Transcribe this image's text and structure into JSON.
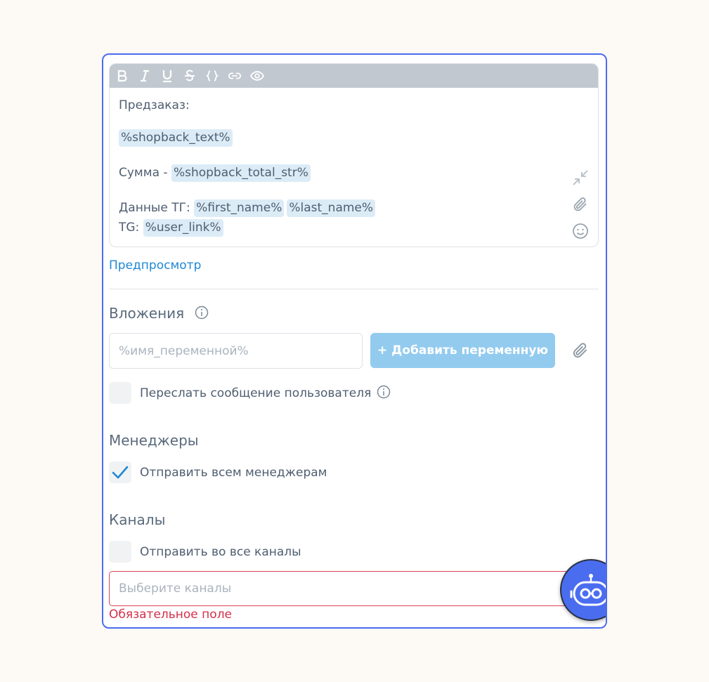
{
  "editor": {
    "lines": {
      "preorder": "Предзаказ:",
      "shopback_text": "%shopback_text%",
      "sum_label": "Сумма -",
      "shopback_total": "%shopback_total_str%",
      "tg_data_label": "Данные ТГ:",
      "first_name": "%first_name%",
      "last_name": "%last_name%",
      "tg_label": "TG:",
      "user_link": "%user_link%"
    }
  },
  "preview_link": "Предпросмотр",
  "attachments": {
    "title": "Вложения",
    "input_placeholder": "%имя_переменной%",
    "add_button": "+ Добавить переменную",
    "forward_label": "Переслать сообщение пользователя"
  },
  "managers": {
    "title": "Менеджеры",
    "send_all_label": "Отправить всем менеджерам",
    "send_all_checked": true
  },
  "channels": {
    "title": "Каналы",
    "send_all_label": "Отправить во все каналы",
    "select_placeholder": "Выберите каналы",
    "error": "Обязательное поле"
  },
  "colors": {
    "accent": "#4a6df0",
    "link": "#1e88d6",
    "error": "#d42f4a",
    "button": "#93cbef",
    "chip": "#dcecf7"
  }
}
